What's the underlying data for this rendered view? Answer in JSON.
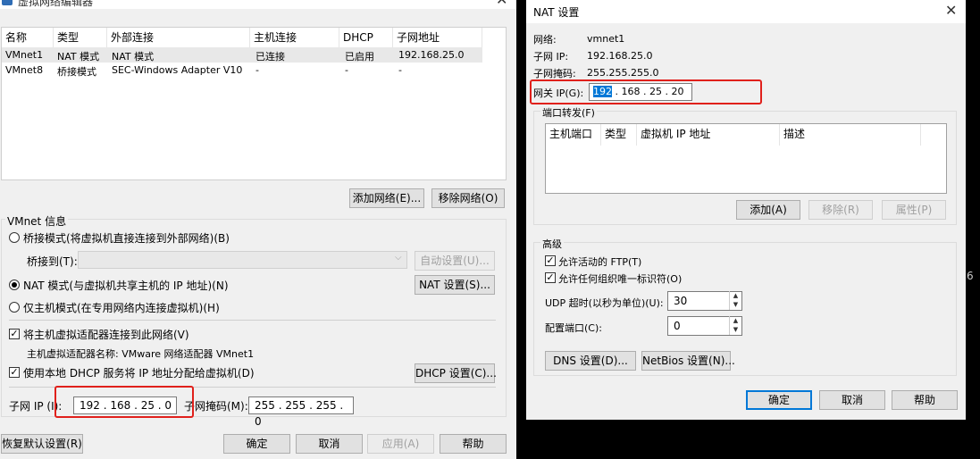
{
  "left": {
    "title": "虚拟网络编辑器",
    "table": {
      "headers": [
        "名称",
        "类型",
        "外部连接",
        "主机连接",
        "DHCP",
        "子网地址"
      ],
      "rows": [
        [
          "VMnet1",
          "NAT 模式",
          "NAT 模式",
          "已连接",
          "已启用",
          "192.168.25.0"
        ],
        [
          "VMnet8",
          "桥接模式",
          "SEC-Windows Adapter V10",
          "-",
          "-",
          "-"
        ]
      ]
    },
    "add_network": "添加网络(E)...",
    "remove_network": "移除网络(O)",
    "vmnet_info": "VMnet 信息",
    "bridged_mode": "桥接模式(将虚拟机直接连接到外部网络)(B)",
    "bridged_to": "桥接到(T):",
    "auto_settings": "自动设置(U)...",
    "nat_mode": "NAT 模式(与虚拟机共享主机的 IP 地址)(N)",
    "nat_settings": "NAT 设置(S)...",
    "host_only": "仅主机模式(在专用网络内连接虚拟机)(H)",
    "connect_adapter": "将主机虚拟适配器连接到此网络(V)",
    "adapter_name": "主机虚拟适配器名称: VMware 网络适配器 VMnet1",
    "use_dhcp": "使用本地 DHCP 服务将 IP 地址分配给虚拟机(D)",
    "dhcp_settings": "DHCP 设置(C)...",
    "subnet_ip_label": "子网 IP (I):",
    "subnet_ip": "192 . 168 . 25  .  0",
    "subnet_mask_label": "子网掩码(M):",
    "subnet_mask": "255 . 255 . 255 .  0",
    "restore": "恢复默认设置(R)",
    "ok": "确定",
    "cancel": "取消",
    "apply": "应用(A)",
    "help": "帮助"
  },
  "nat": {
    "title": "NAT 设置",
    "network_label": "网络:",
    "network": "vmnet1",
    "subnet_ip_label": "子网 IP:",
    "subnet_ip": "192.168.25.0",
    "subnet_mask_label": "子网掩码:",
    "subnet_mask": "255.255.255.0",
    "gateway_label": "网关 IP(G):",
    "gateway_first": "192",
    "gateway_rest": " . 168 .  25  .  20",
    "port_forwarding": "端口转发(F)",
    "pf_headers": [
      "主机端口",
      "类型",
      "虚拟机 IP 地址",
      "描述"
    ],
    "add": "添加(A)",
    "remove": "移除(R)",
    "properties": "属性(P)",
    "advanced": "高级",
    "allow_ftp": "允许活动的 FTP(T)",
    "allow_oui": "允许任何组织唯一标识符(O)",
    "udp_timeout_label": "UDP 超时(以秒为单位)(U):",
    "udp_timeout": "30",
    "config_port_label": "配置端口(C):",
    "config_port": "0",
    "dns": "DNS 设置(D)...",
    "netbios": "NetBios 设置(N)...",
    "ok": "确定",
    "cancel": "取消",
    "help": "帮助"
  },
  "stray": "6"
}
